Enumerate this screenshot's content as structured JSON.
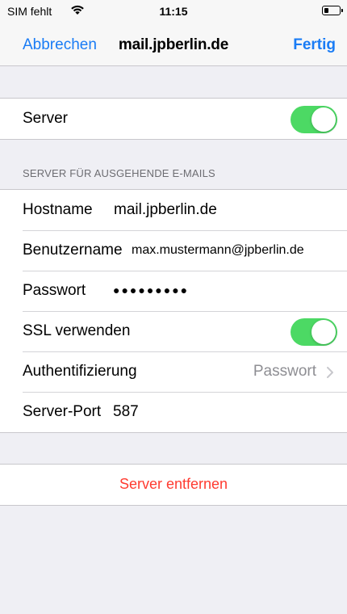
{
  "status_bar": {
    "carrier": "SIM fehlt",
    "time": "11:15",
    "wifi_icon": "wifi-icon",
    "battery_icon": "battery-icon",
    "battery_level": 0.2
  },
  "nav": {
    "cancel_label": "Abbrechen",
    "title": "mail.jpberlin.de",
    "done_label": "Fertig"
  },
  "server_group": {
    "server_label": "Server",
    "server_enabled": true
  },
  "outgoing_section": {
    "header": "SERVER FÜR AUSGEHENDE E-MAILS",
    "hostname_label": "Hostname",
    "hostname_value": "mail.jpberlin.de",
    "username_label": "Benutzername",
    "username_value": "max.mustermann@jpberlin.de",
    "password_label": "Passwort",
    "password_value": "●●●●●●●●●",
    "ssl_label": "SSL verwenden",
    "ssl_enabled": true,
    "auth_label": "Authentifizierung",
    "auth_value": "Passwort",
    "port_label": "Server-Port",
    "port_value": "587"
  },
  "remove_label": "Server entfernen",
  "colors": {
    "accent": "#1a7cf5",
    "toggle_on": "#4cd964",
    "destructive": "#ff3b30",
    "background": "#efeff4"
  }
}
